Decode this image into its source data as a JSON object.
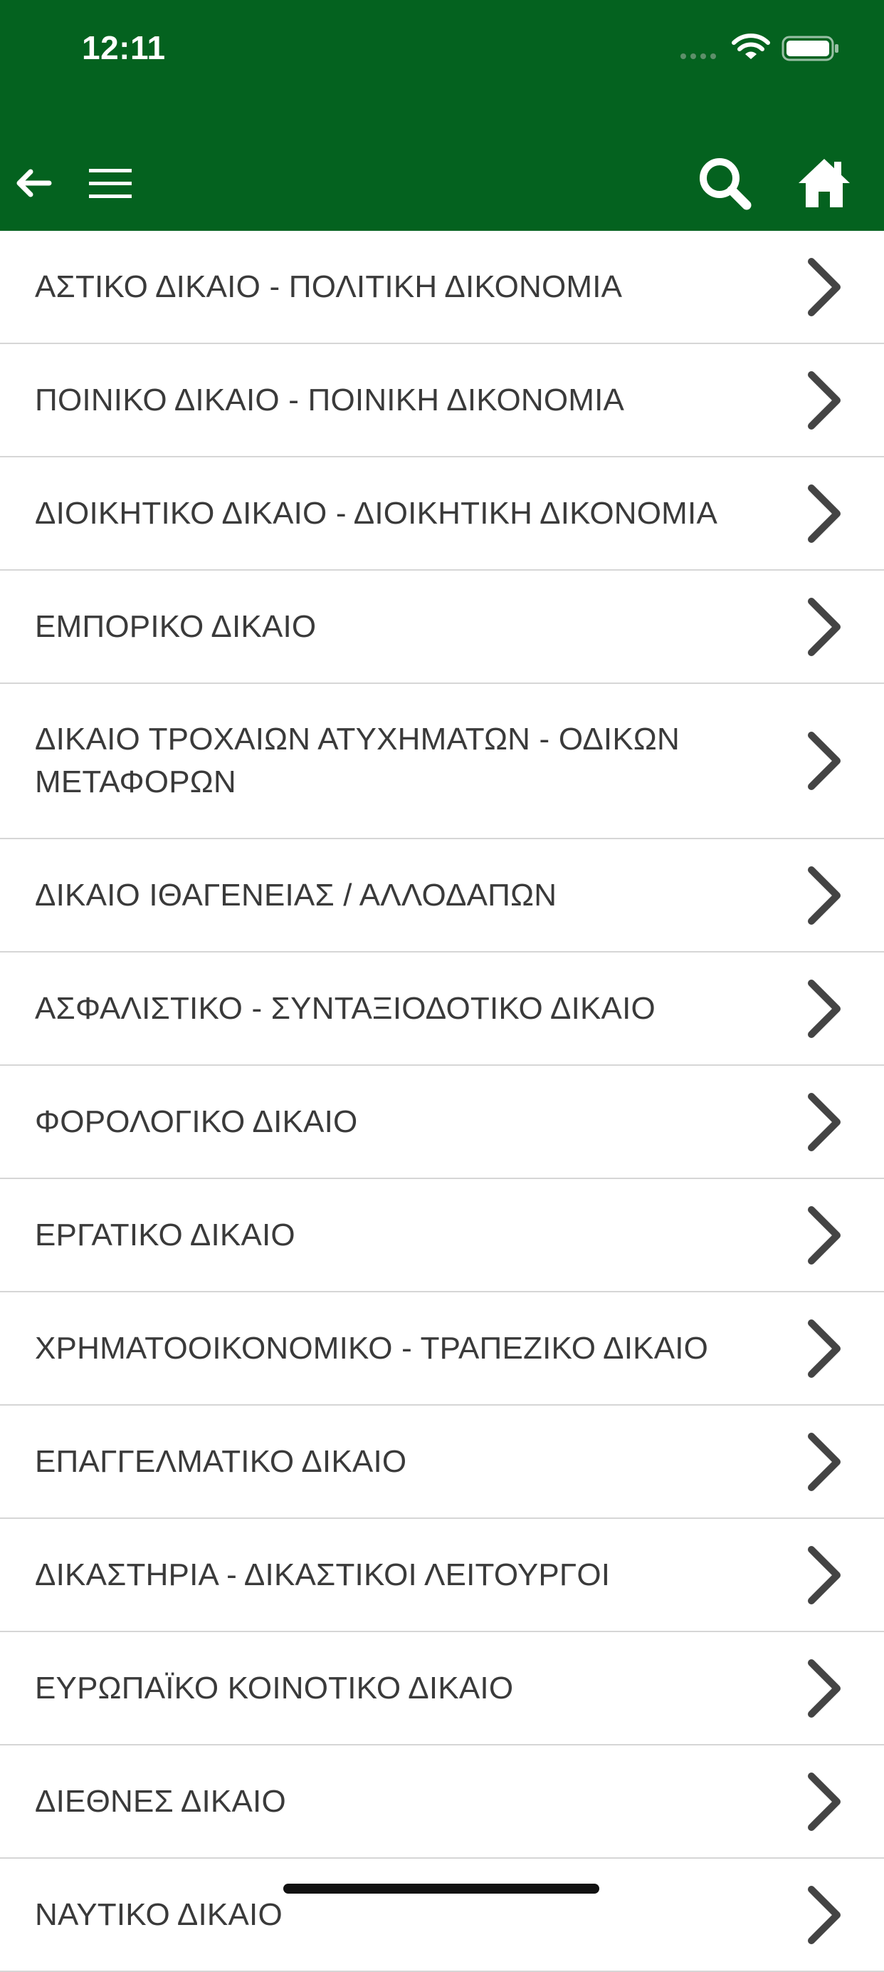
{
  "status_bar": {
    "time": "12:11"
  },
  "toolbar": {
    "back_icon": "arrow-left-icon",
    "menu_icon": "hamburger-menu-icon",
    "search_icon": "search-icon",
    "home_icon": "home-icon"
  },
  "colors": {
    "header_bg": "#04621f",
    "text": "#3a3a3a",
    "chevron": "#444444",
    "divider": "#d6d6d6"
  },
  "items": [
    {
      "label": "ΑΣΤΙΚΟ ΔΙΚΑΙΟ - ΠΟΛΙΤΙΚΗ ΔΙΚΟΝΟΜΙΑ"
    },
    {
      "label": "ΠΟΙΝΙΚΟ ΔΙΚΑΙΟ - ΠΟΙΝΙΚΗ ΔΙΚΟΝΟΜΙΑ"
    },
    {
      "label": "ΔΙΟΙΚΗΤΙΚΟ ΔΙΚΑΙΟ - ΔΙΟΙΚΗΤΙΚΗ ΔΙΚΟΝΟΜΙΑ"
    },
    {
      "label": "ΕΜΠΟΡΙΚΟ ΔΙΚΑΙΟ"
    },
    {
      "label": "ΔΙΚΑΙΟ ΤΡΟΧΑΙΩΝ ΑΤΥΧΗΜΑΤΩΝ - ΟΔΙΚΩΝ ΜΕΤΑΦΟΡΩΝ"
    },
    {
      "label": "ΔΙΚΑΙΟ ΙΘΑΓΕΝΕΙΑΣ / ΑΛΛΟΔΑΠΩΝ"
    },
    {
      "label": "ΑΣΦΑΛΙΣΤΙΚΟ - ΣΥΝΤΑΞΙΟΔΟΤΙΚΟ ΔΙΚΑΙΟ"
    },
    {
      "label": "ΦΟΡΟΛΟΓΙΚΟ ΔΙΚΑΙΟ"
    },
    {
      "label": "ΕΡΓΑΤΙΚΟ ΔΙΚΑΙΟ"
    },
    {
      "label": "ΧΡΗΜΑΤΟΟΙΚΟΝΟΜΙΚΟ - ΤΡΑΠΕΖΙΚΟ ΔΙΚΑΙΟ"
    },
    {
      "label": "ΕΠΑΓΓΕΛΜΑΤΙΚΟ ΔΙΚΑΙΟ"
    },
    {
      "label": "ΔΙΚΑΣΤΗΡΙΑ - ΔΙΚΑΣΤΙΚΟΙ ΛΕΙΤΟΥΡΓΟΙ"
    },
    {
      "label": "ΕΥΡΩΠΑΪΚΟ ΚΟΙΝΟΤΙΚΟ ΔΙΚΑΙΟ"
    },
    {
      "label": "ΔΙΕΘΝΕΣ ΔΙΚΑΙΟ"
    },
    {
      "label": "ΝΑΥΤΙΚΟ ΔΙΚΑΙΟ"
    }
  ]
}
